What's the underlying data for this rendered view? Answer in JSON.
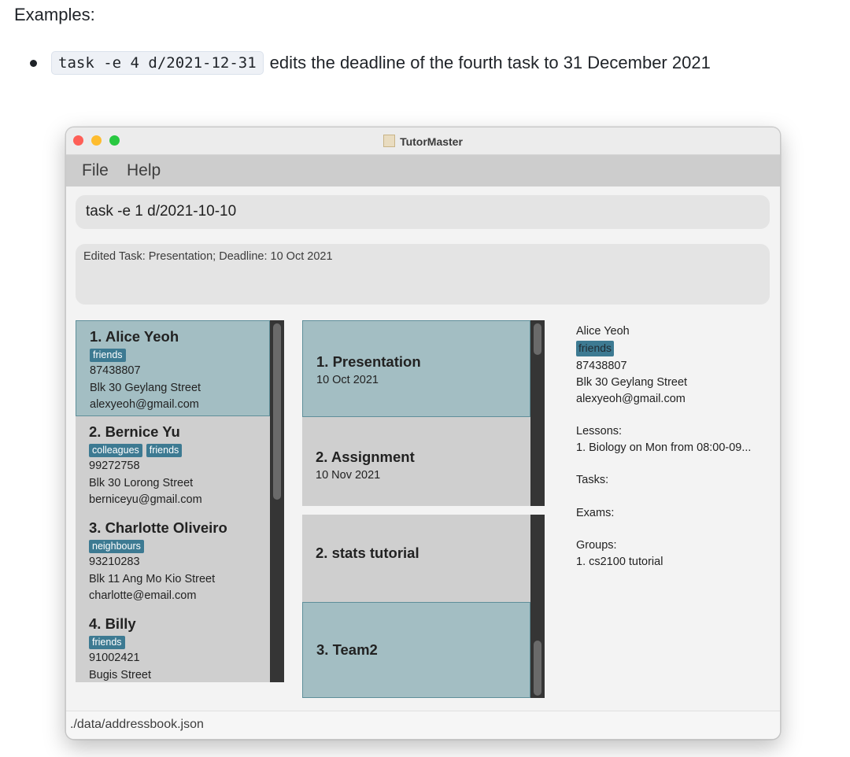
{
  "doc": {
    "heading": "Examples:",
    "bullet_code": "task -e 4 d/2021-12-31",
    "bullet_text": "edits the deadline of the fourth task to 31 December 2021"
  },
  "window": {
    "title": "TutorMaster",
    "menu": {
      "file": "File",
      "help": "Help"
    },
    "command": "task -e 1 d/2021-10-10",
    "result": "Edited Task: Presentation; Deadline: 10 Oct 2021",
    "status": "./data/addressbook.json"
  },
  "persons": [
    {
      "name": "1.  Alice Yeoh",
      "tags": [
        "friends"
      ],
      "phone": "87438807",
      "address": "Blk 30 Geylang Street",
      "email": "alexyeoh@gmail.com"
    },
    {
      "name": "2.  Bernice Yu",
      "tags": [
        "colleagues",
        "friends"
      ],
      "phone": "99272758",
      "address": "Blk 30 Lorong Street",
      "email": "berniceyu@gmail.com"
    },
    {
      "name": "3.  Charlotte Oliveiro",
      "tags": [
        "neighbours"
      ],
      "phone": "93210283",
      "address": "Blk 11 Ang Mo Kio Street",
      "email": "charlotte@email.com"
    },
    {
      "name": "4.  Billy",
      "tags": [
        "friends"
      ],
      "phone": "91002421",
      "address": "Bugis Street",
      "email": ""
    }
  ],
  "tasks": [
    {
      "title": "1.  Presentation",
      "date": "10 Oct 2021"
    },
    {
      "title": "2.  Assignment",
      "date": "10 Nov 2021"
    }
  ],
  "groups": [
    {
      "title": "2.  stats tutorial"
    },
    {
      "title": "3.  Team2"
    }
  ],
  "detail": {
    "name": "Alice Yeoh",
    "tag": "friends",
    "phone": "87438807",
    "address": "Blk 30 Geylang Street",
    "email": "alexyeoh@gmail.com",
    "lessons_label": "Lessons:",
    "lesson_1": "1. Biology on Mon from 08:00-09...",
    "tasks_label": "Tasks:",
    "exams_label": "Exams:",
    "groups_label": "Groups:",
    "group_1": "1. cs2100 tutorial"
  }
}
